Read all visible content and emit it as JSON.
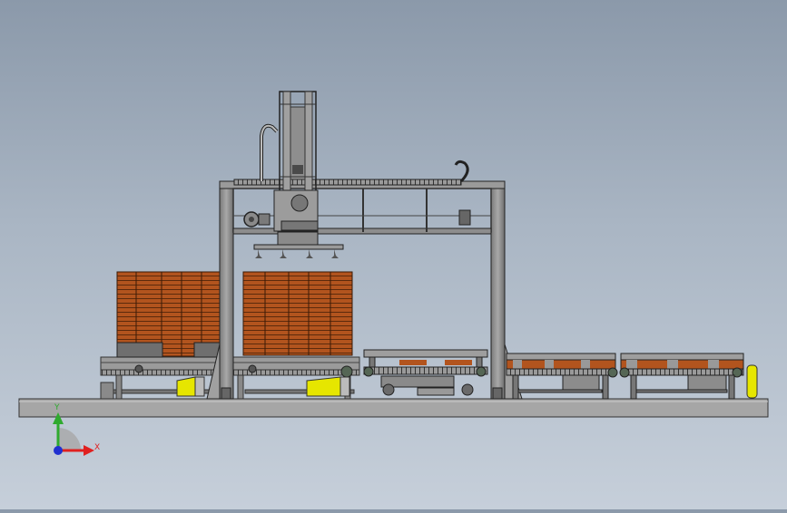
{
  "viewport": {
    "background_top": "#8b99aa",
    "background_bottom": "#c6cfda"
  },
  "model": {
    "frame_color": "#8e8e8e",
    "stack_color": "#b2541e",
    "guard_color": "#e6e600",
    "base_color": "#a3a3a3"
  },
  "triad": {
    "y_label": "Y",
    "x_label": "X",
    "y_color": "#2faa2f",
    "x_color": "#e02020",
    "z_color": "#2030d0"
  }
}
